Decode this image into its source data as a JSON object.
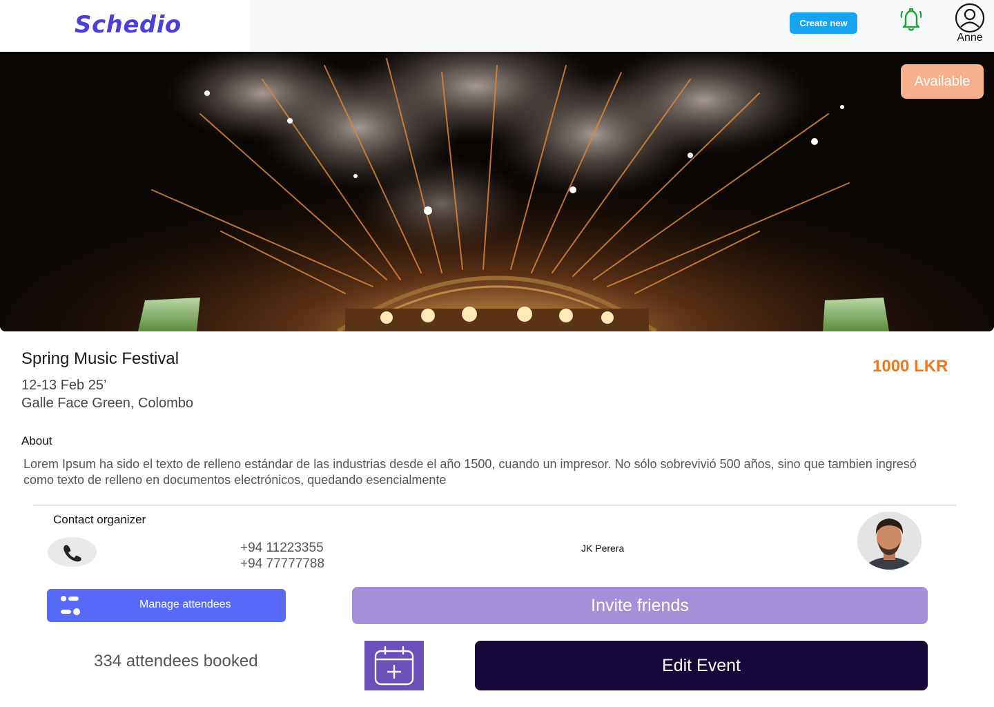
{
  "brand": {
    "name": "Schedio",
    "color": "#4b3fd6"
  },
  "header": {
    "create_label": "Create new",
    "bell_icon": "bell-icon",
    "user_icon": "user-avatar-icon",
    "user_name": "Anne"
  },
  "hero": {
    "image": "fireworks-over-stage-photo",
    "status": "Available"
  },
  "event": {
    "title": "Spring Music Festival",
    "price": "1000 LKR",
    "date": "12-13 Feb 25’",
    "location": "Galle Face Green, Colombo"
  },
  "about": {
    "heading": "About",
    "text": "Lorem Ipsum ha sido el texto de relleno estándar de las industrias desde el año 1500, cuando un impresor. No sólo sobrevivió 500 años, sino que tambien ingresó como texto de relleno en documentos electrónicos, quedando esencialmente"
  },
  "contact": {
    "heading": "Contact organizer",
    "phone_icon": "phone-icon",
    "phones": [
      "+94 11223355",
      "+94 77777788"
    ],
    "organizer_name": "JK Perera"
  },
  "actions": {
    "manage_label": "Manage attendees",
    "invite_label": "Invite friends",
    "attendees_text": "334 attendees booked",
    "calendar_icon": "calendar-add-icon",
    "edit_label": "Edit Event"
  },
  "colors": {
    "create": "#16a4f0",
    "available": "#f6b08c",
    "price": "#f0771e",
    "manage": "#5669f7",
    "invite": "#a58fd8",
    "calendar": "#6b4fbb",
    "edit": "#170a3a"
  }
}
